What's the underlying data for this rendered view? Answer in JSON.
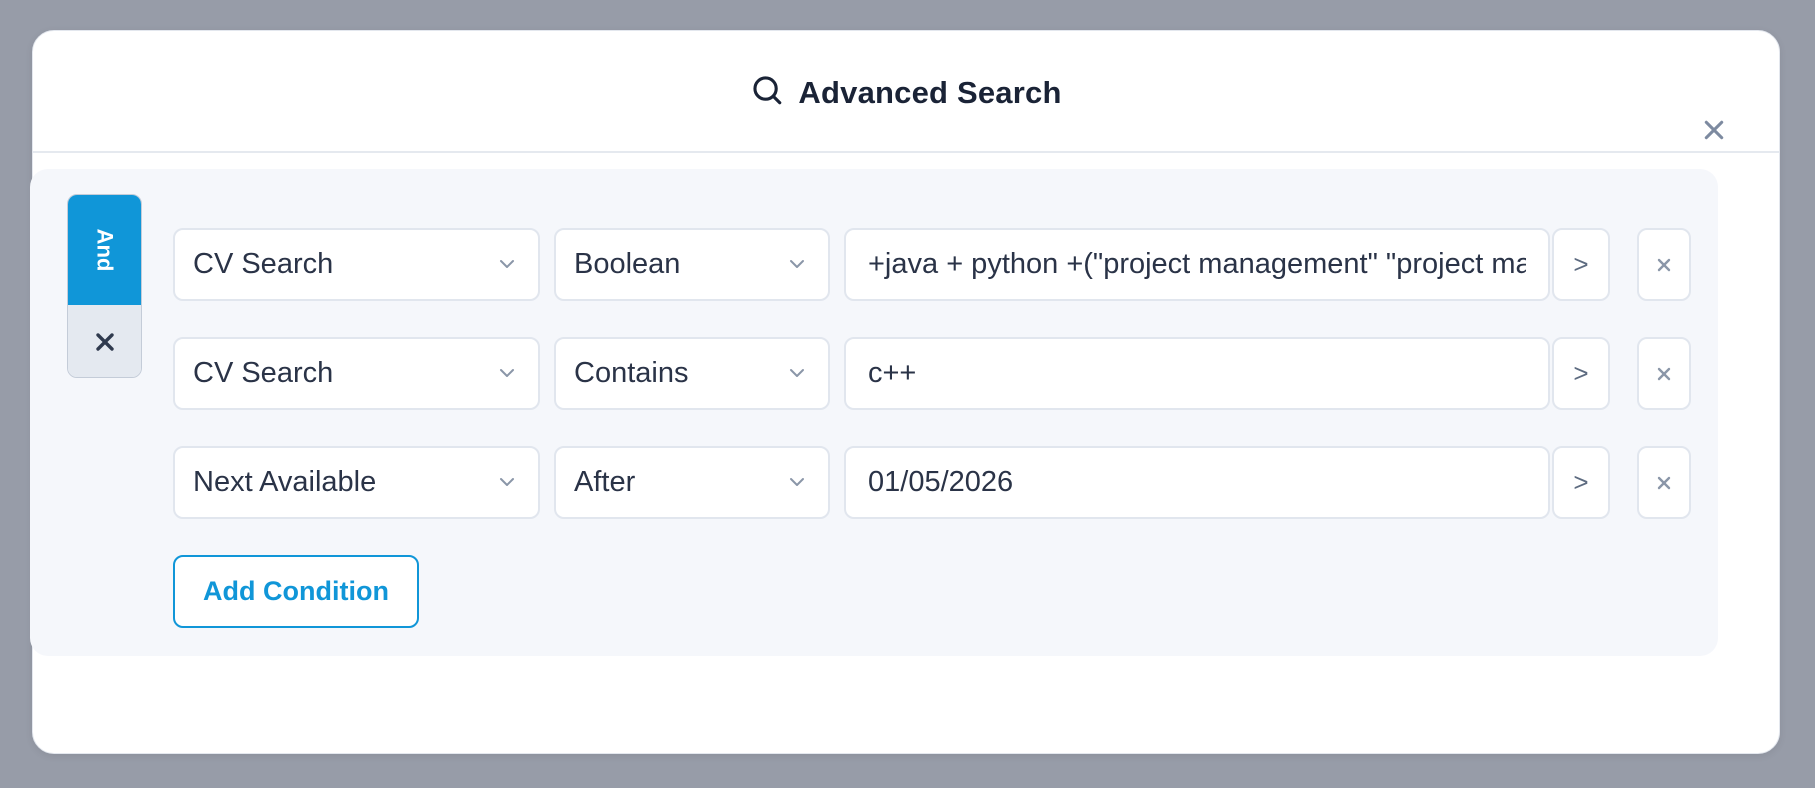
{
  "modal": {
    "title": "Advanced Search",
    "title_icon": "search-icon",
    "close_icon": "close-icon"
  },
  "group": {
    "logic_label": "And",
    "remove_icon": "close-icon"
  },
  "conditions": [
    {
      "field": "CV Search",
      "operator": "Boolean",
      "value": "+java + python +(\"project management\" \"project manager\")",
      "go_label": ">"
    },
    {
      "field": "CV Search",
      "operator": "Contains",
      "value": "c++",
      "go_label": ">"
    },
    {
      "field": "Next Available",
      "operator": "After",
      "value": "01/05/2026",
      "go_label": ">"
    }
  ],
  "add_condition_label": "Add Condition",
  "colors": {
    "accent": "#1096d8",
    "backdrop": "#979ca8",
    "panel": "#f5f7fb",
    "text": "#2a3347"
  }
}
